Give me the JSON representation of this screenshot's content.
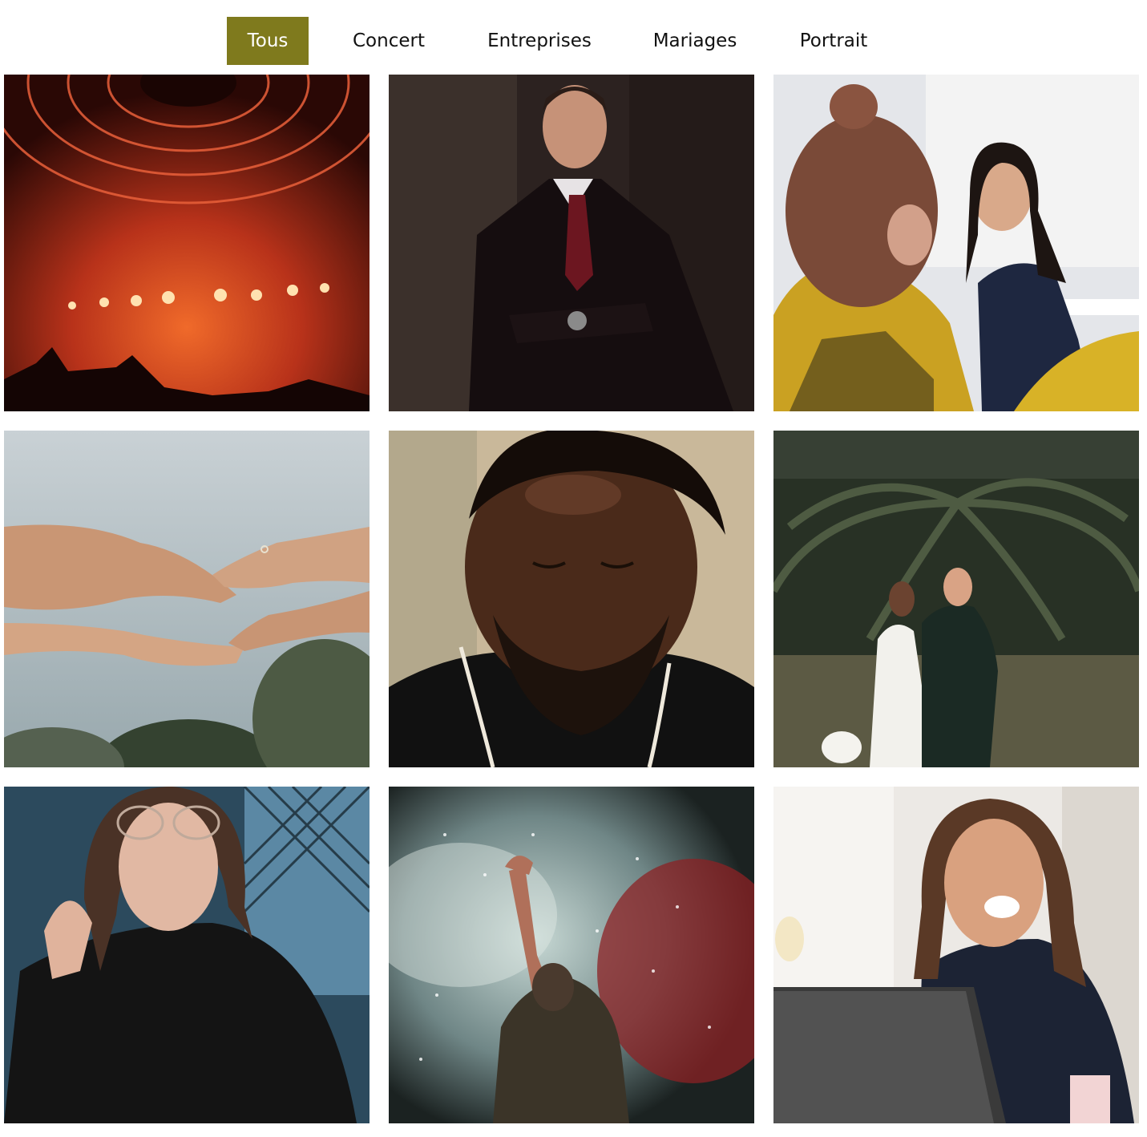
{
  "filters": [
    {
      "label": "Tous",
      "active": true
    },
    {
      "label": "Concert",
      "active": false
    },
    {
      "label": "Entreprises",
      "active": false
    },
    {
      "label": "Mariages",
      "active": false
    },
    {
      "label": "Portrait",
      "active": false
    }
  ],
  "colors": {
    "accent": "#7f7a1d",
    "background": "#ffffff",
    "text": "#111111"
  },
  "gallery": [
    {
      "subject": "concert stage with red lights and truss ring",
      "icon": "concert-photo"
    },
    {
      "subject": "man in dark suit with arms crossed",
      "icon": "business-portrait-photo"
    },
    {
      "subject": "smiling woman in office meeting",
      "icon": "office-meeting-photo"
    },
    {
      "subject": "hands reaching toward each other with ring",
      "icon": "wedding-hands-photo"
    },
    {
      "subject": "close-up portrait of bearded man with eyes closed",
      "icon": "portrait-photo"
    },
    {
      "subject": "bride and groom walking under palm tree",
      "icon": "wedding-couple-photo"
    },
    {
      "subject": "young woman with glasses by fence",
      "icon": "portrait-photo"
    },
    {
      "subject": "performer with raised hand in smoke",
      "icon": "concert-photo"
    },
    {
      "subject": "laughing woman at laptop",
      "icon": "office-photo"
    }
  ]
}
